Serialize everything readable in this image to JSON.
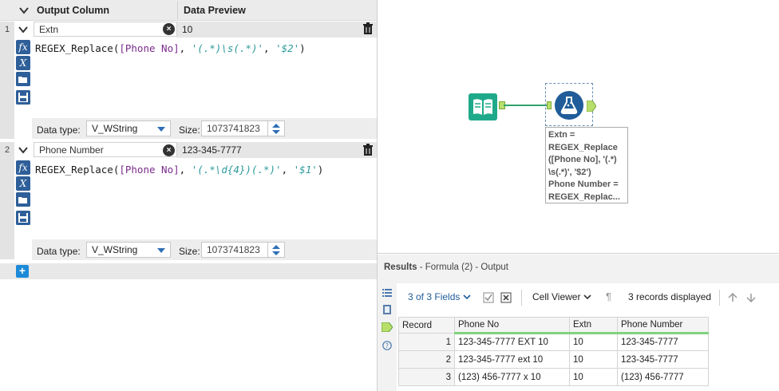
{
  "header": {
    "output_column": "Output Column",
    "data_preview": "Data Preview"
  },
  "rows": [
    {
      "index": "1",
      "name": "Extn",
      "preview": "10",
      "expression": {
        "func": "REGEX_Replace(",
        "field": "[Phone No]",
        "sep1": ", ",
        "pattern": "'(.*)\\s(.*)'",
        "sep2": ", ",
        "replacement": "'$2'",
        "close": ")"
      },
      "data_type_label": "Data type:",
      "data_type": "V_WString",
      "size_label": "Size:",
      "size": "1073741823"
    },
    {
      "index": "2",
      "name": "Phone Number",
      "preview": "123-345-7777",
      "expression": {
        "func": "REGEX_Replace(",
        "field": "[Phone No]",
        "sep1": ", ",
        "pattern": "'(.*\\d{4})(.*)'",
        "sep2": ", ",
        "replacement": "'$1'",
        "close": ")"
      },
      "data_type_label": "Data type:",
      "data_type": "V_WString",
      "size_label": "Size:",
      "size": "1073741823"
    }
  ],
  "tool_buttons": [
    "fx",
    "X"
  ],
  "add_label": "+",
  "canvas": {
    "annotation": "Extn =\nREGEX_Replace\n([Phone No], '(.*)\n\\s(.*)', '$2')\nPhone Number =\nREGEX_Replac..."
  },
  "results": {
    "title": "Results",
    "subtitle": " - Formula (2) - Output",
    "fields": "3 of 3 Fields",
    "cell_viewer": "Cell Viewer",
    "records_displayed": "3 records displayed",
    "columns": [
      "Record",
      "Phone No",
      "Extn",
      "Phone Number"
    ],
    "data": [
      [
        "1",
        "123-345-7777 EXT 10",
        "10",
        "123-345-7777"
      ],
      [
        "2",
        "123-345-7777 ext 10",
        "10",
        "123-345-7777"
      ],
      [
        "3",
        "(123) 456-7777 x 10",
        "10",
        "(123) 456-7777"
      ]
    ]
  },
  "colors": {
    "accent_blue": "#1f5c99",
    "input_teal": "#1eaa8a",
    "anchor_green": "#b8df6a",
    "string_teal": "#2e9a9a",
    "field_purple": "#7a2b8a"
  },
  "icons": [
    "chevron-down-icon",
    "clear-icon",
    "trash-icon",
    "fx-icon",
    "variable-icon",
    "folder-open-icon",
    "save-icon",
    "plus-icon",
    "book-icon",
    "flask-icon",
    "list-icon",
    "grid-icon",
    "output-anchor-icon",
    "help-icon",
    "checkbox-icon",
    "close-box-icon",
    "pilcrow-icon",
    "arrow-up-icon",
    "arrow-down-icon"
  ]
}
